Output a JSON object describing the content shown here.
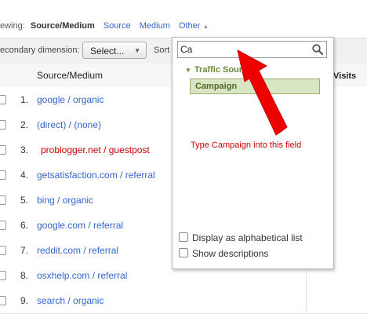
{
  "viewing": {
    "label": "ewing:",
    "selected": "Source/Medium",
    "links": [
      "Source",
      "Medium"
    ],
    "other": "Other"
  },
  "toolbar": {
    "secondary_label": "econdary dimension:",
    "select_label": "Select...",
    "sort_label": "Sort"
  },
  "table": {
    "column_header": "Source/Medium",
    "visits_header": "Visits",
    "rows": [
      {
        "num": "1.",
        "source": "google / organic"
      },
      {
        "num": "2.",
        "source": "(direct) / (none)"
      },
      {
        "num": "3.",
        "source": "problogger.net / guestpost"
      },
      {
        "num": "4.",
        "source": "getsatisfaction.com / referral"
      },
      {
        "num": "5.",
        "source": "bing / organic"
      },
      {
        "num": "6.",
        "source": "google.com / referral"
      },
      {
        "num": "7.",
        "source": "reddit.com / referral"
      },
      {
        "num": "8.",
        "source": "osxhelp.com / referral"
      },
      {
        "num": "9.",
        "source": "search / organic"
      }
    ]
  },
  "dropdown": {
    "search_value": "Ca",
    "category": "Traffic Sources",
    "highlighted_item": "Campaign",
    "annotation": "Type Campaign into this field",
    "options": [
      "Display as alphabetical list",
      "Show descriptions"
    ]
  },
  "colors": {
    "link": "#3366cc",
    "annotation_red": "#cc0000",
    "highlight_green": "#d9e6c4"
  },
  "icons": [
    "search-icon",
    "chevron-down-icon",
    "triangle-expand-icon",
    "checkbox-icon"
  ]
}
